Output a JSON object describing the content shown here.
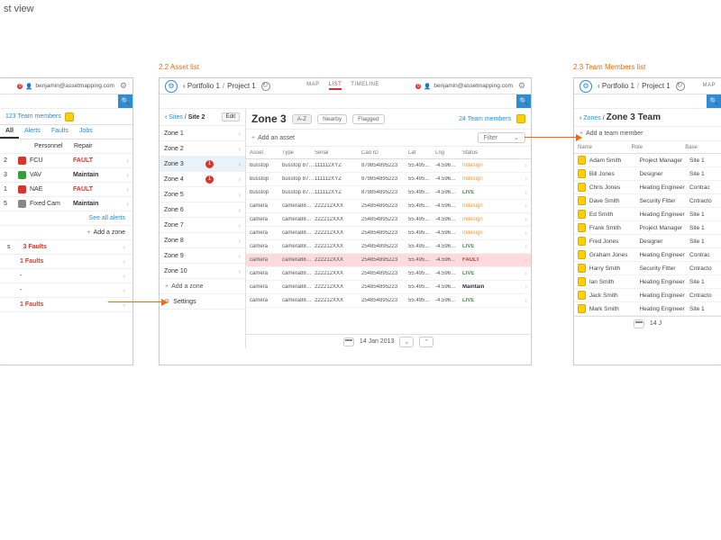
{
  "page": {
    "title": "st view"
  },
  "captions": {
    "asset_list": "2.2 Asset list",
    "team_list": "2.3 Team Members list"
  },
  "header": {
    "user": "benjamin@assetmapping.com",
    "notif": "0",
    "bc1": "Portfolio 1",
    "bc2": "Project 1",
    "tabs": [
      "MAP",
      "LIST",
      "TIMELINE"
    ]
  },
  "panel1": {
    "team": "123 Team members",
    "tabs": [
      "All",
      "Alerts",
      "Faults",
      "Jobs"
    ],
    "cols": [
      "",
      "Personnel",
      "Repair"
    ],
    "rows": [
      {
        "id": "2",
        "badge": "red",
        "asset": "FCU",
        "status": "FAULT"
      },
      {
        "id": "3",
        "badge": "grn",
        "asset": "VAV",
        "status": "Maintain"
      },
      {
        "id": "1",
        "badge": "red",
        "asset": "NAE",
        "status": "FAULT"
      },
      {
        "id": "5",
        "badge": "gry",
        "asset": "Fixed Cam",
        "status": "Maintain"
      }
    ],
    "see_all": "See all alerts",
    "add_zone": "Add a zone",
    "summary": [
      {
        "label": "s",
        "val": "3 Faults"
      },
      {
        "label": "",
        "val": "1 Faults"
      },
      {
        "label": "",
        "val": "-"
      },
      {
        "label": "",
        "val": "-"
      },
      {
        "label": "",
        "val": "1 Faults"
      }
    ]
  },
  "panel2": {
    "side_bc": [
      "Sites",
      "Site 2"
    ],
    "edit": "Edit",
    "zones": [
      {
        "name": "Zone 1",
        "sel": false,
        "alerts": 0
      },
      {
        "name": "Zone 2",
        "sel": false,
        "alerts": 0
      },
      {
        "name": "Zone 3",
        "sel": true,
        "alerts": 1
      },
      {
        "name": "Zone 4",
        "sel": false,
        "alerts": 1
      },
      {
        "name": "Zone 5",
        "sel": false,
        "alerts": 0
      },
      {
        "name": "Zone 6",
        "sel": false,
        "alerts": 0
      },
      {
        "name": "Zone 7",
        "sel": false,
        "alerts": 0
      },
      {
        "name": "Zone 8",
        "sel": false,
        "alerts": 0
      },
      {
        "name": "Zone 9",
        "sel": false,
        "alerts": 0
      },
      {
        "name": "Zone 10",
        "sel": false,
        "alerts": 0
      }
    ],
    "add_zone": "Add a zone",
    "settings": "Settings",
    "zone_title": "Zone 3",
    "pills": [
      "A-Z",
      "Nearby",
      "Flagged"
    ],
    "team": "24 Team members",
    "add_asset": "Add an asset",
    "filter": "Filter",
    "th": [
      "Asset",
      "Type",
      "Serial",
      "Cad ID",
      "Lat",
      "Lng",
      "Status"
    ],
    "assets": [
      {
        "a": "busstop",
        "t": "busstop 87985...",
        "s": "111112XYZ",
        "c": "879854895223",
        "la": "55.495...",
        "ln": "-4.596...",
        "st": "Indesign",
        "cls": "i"
      },
      {
        "a": "busstop",
        "t": "busstop 87985...",
        "s": "111112XYZ",
        "c": "879854895223",
        "la": "55.495...",
        "ln": "-4.596...",
        "st": "Indesign",
        "cls": "i"
      },
      {
        "a": "busstop",
        "t": "busstop 87985...",
        "s": "111112XYZ",
        "c": "879854895223",
        "la": "55.495...",
        "ln": "-4.596...",
        "st": "LIVE",
        "cls": "l"
      },
      {
        "a": "camera",
        "t": "camera8885...",
        "s": "222212XXX",
        "c": "254854895223",
        "la": "55.495...",
        "ln": "-4.596...",
        "st": "Indesign",
        "cls": "i"
      },
      {
        "a": "camera",
        "t": "camera8885...",
        "s": "222212XXX",
        "c": "254854895223",
        "la": "55.495...",
        "ln": "-4.596...",
        "st": "Indesign",
        "cls": "i"
      },
      {
        "a": "camera",
        "t": "camera8885...",
        "s": "222212XXX",
        "c": "254854895223",
        "la": "55.495...",
        "ln": "-4.596...",
        "st": "Indesign",
        "cls": "i"
      },
      {
        "a": "camera",
        "t": "camera8885...",
        "s": "222212XXX",
        "c": "254854895223",
        "la": "55.495...",
        "ln": "-4.596...",
        "st": "LIVE",
        "cls": "l"
      },
      {
        "a": "camera",
        "t": "camera8885...",
        "s": "222212XXX",
        "c": "254854895223",
        "la": "55.495...",
        "ln": "-4.596...",
        "st": "FAULT",
        "cls": "f",
        "pink": true
      },
      {
        "a": "camera",
        "t": "camera8885...",
        "s": "222212XXX",
        "c": "254854895223",
        "la": "55.495...",
        "ln": "-4.596...",
        "st": "LIVE",
        "cls": "l"
      },
      {
        "a": "camera",
        "t": "camera8885...",
        "s": "222212XXX",
        "c": "254854895223",
        "la": "55.495...",
        "ln": "-4.596...",
        "st": "Maintain",
        "cls": "m"
      },
      {
        "a": "camera",
        "t": "camera8885...",
        "s": "222212XXX",
        "c": "254854895223",
        "la": "55.495...",
        "ln": "-4.596...",
        "st": "LIVE",
        "cls": "l"
      }
    ],
    "date": "14 Jan 2013"
  },
  "panel3": {
    "bc": "Zones",
    "title": "Zone 3 Team",
    "add": "Add a team member",
    "th": [
      "Name",
      "Role",
      "Base"
    ],
    "members": [
      {
        "n": "Adam Smith",
        "r": "Project Manager",
        "b": "Site 1"
      },
      {
        "n": "Bill Jones",
        "r": "Designer",
        "b": "Site 1"
      },
      {
        "n": "Chris Jones",
        "r": "Heating Engineer",
        "b": "Contrac"
      },
      {
        "n": "Dave Smith",
        "r": "Security Fitter",
        "b": "Cntracto"
      },
      {
        "n": "Ed Smith",
        "r": "Heating Engineer",
        "b": "Site 1"
      },
      {
        "n": "Frank Smith",
        "r": "Project Manager",
        "b": "Site 1"
      },
      {
        "n": "Fred Jones",
        "r": "Designer",
        "b": "Site 1"
      },
      {
        "n": "Graham Jones",
        "r": "Heating Engineer",
        "b": "Contrac"
      },
      {
        "n": "Harry Smith",
        "r": "Security Fitter",
        "b": "Cntracto"
      },
      {
        "n": "Ian Smith",
        "r": "Heating Engineer",
        "b": "Site 1"
      },
      {
        "n": "Jack Smith",
        "r": "Heating Engineer",
        "b": "Cntracto"
      },
      {
        "n": "Mark Smith",
        "r": "Heating Engineer",
        "b": "Site 1"
      }
    ],
    "date": "14 J"
  }
}
